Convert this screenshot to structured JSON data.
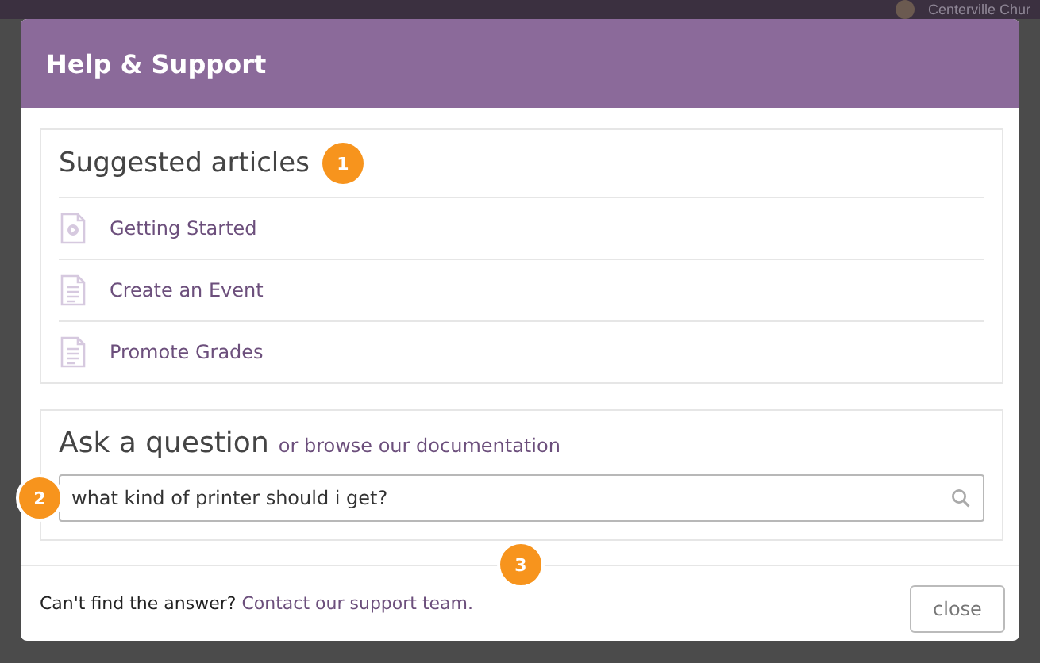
{
  "top_bar": {
    "account_name": "Centerville Chur"
  },
  "dialog": {
    "title": "Help & Support",
    "suggested": {
      "heading": "Suggested articles",
      "badge": "1",
      "articles": [
        {
          "kind": "video",
          "title": "Getting Started"
        },
        {
          "kind": "document",
          "title": "Create an Event"
        },
        {
          "kind": "document",
          "title": "Promote Grades"
        }
      ]
    },
    "ask": {
      "heading": "Ask a question",
      "browse_link": "or browse our documentation",
      "badge": "2",
      "search": {
        "value": "what kind of printer should i get?"
      }
    },
    "footer": {
      "prompt": "Can't find the answer?",
      "link": "Contact our support team.",
      "badge": "3",
      "close_button": "close"
    }
  }
}
